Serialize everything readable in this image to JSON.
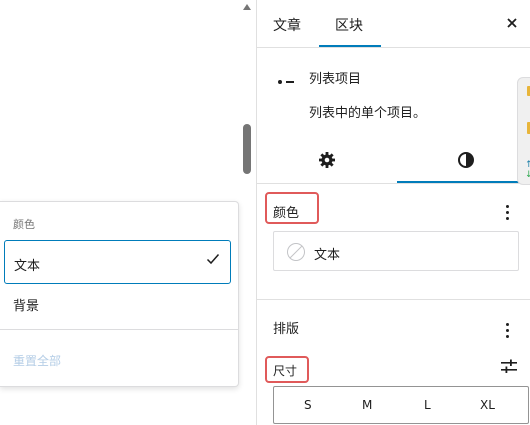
{
  "popover": {
    "heading": "颜色",
    "items": [
      {
        "label": "文本",
        "selected": true
      },
      {
        "label": "背景",
        "selected": false
      }
    ],
    "reset_label": "重置全部"
  },
  "sidebar": {
    "tabs": [
      {
        "label": "文章",
        "active": false
      },
      {
        "label": "区块",
        "active": true
      }
    ],
    "close_icon": "close-icon",
    "block": {
      "icon": "list-item-icon",
      "title": "列表项目",
      "description": "列表中的单个项目。"
    },
    "mini_tabs": [
      {
        "icon": "gear-icon",
        "active": false
      },
      {
        "icon": "styles-icon",
        "active": true
      }
    ],
    "color_section": {
      "label": "颜色",
      "items": [
        {
          "label": "文本",
          "swatch": "none"
        }
      ]
    },
    "typography_section": {
      "label": "排版",
      "size_label": "尺寸",
      "size_options": [
        "S",
        "M",
        "L",
        "XL"
      ]
    }
  },
  "colors": {
    "accent": "#007cba",
    "highlight": "#e05a5a"
  }
}
